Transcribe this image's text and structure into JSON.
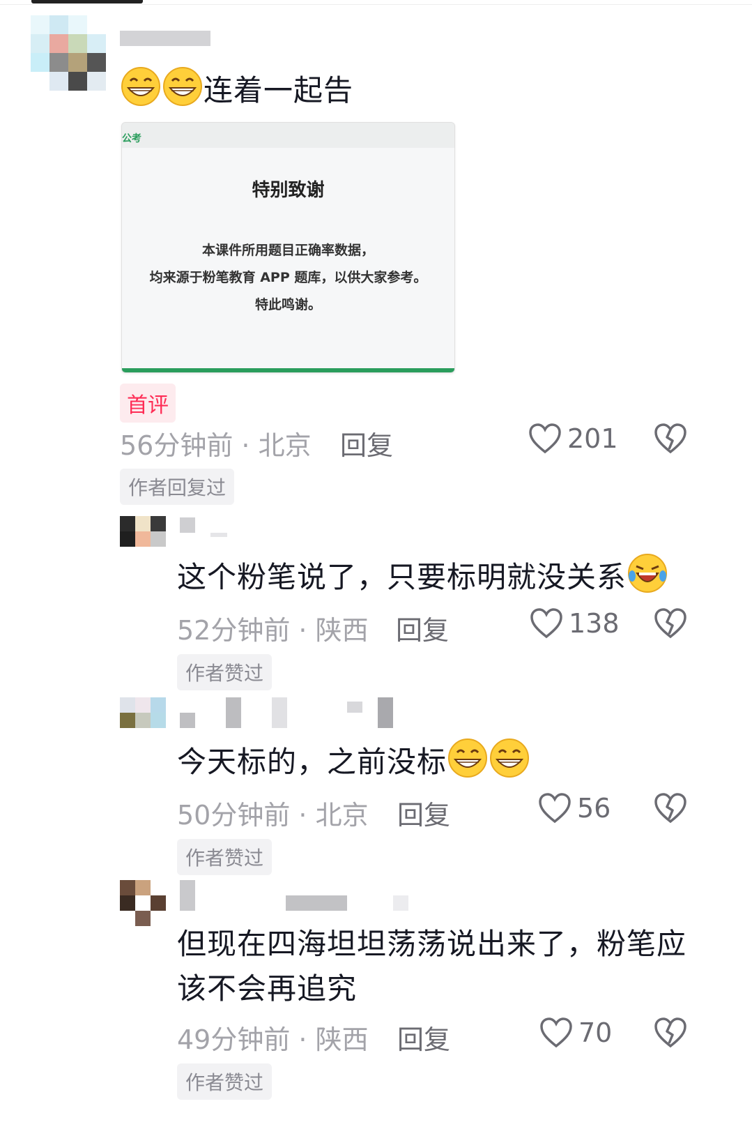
{
  "comments": [
    {
      "text_main": "连着一起告",
      "emojis": [
        "grin-emoji",
        "grin-emoji"
      ],
      "attachment": {
        "logo_text": "公考",
        "title": "特别致谢",
        "lines": [
          "本课件所用题目正确率数据，",
          "均来源于粉笔教育 APP 题库，以供大家参考。",
          "特此鸣谢。"
        ]
      },
      "first_badge": "首评",
      "time": "56分钟前 · 北京",
      "reply": "回复",
      "likes": "201",
      "badge": "作者回复过"
    },
    {
      "text_main": "这个粉笔说了，只要标明就没关系",
      "emojis": [
        "laugh-cry-emoji"
      ],
      "time": "52分钟前 · 陕西",
      "reply": "回复",
      "likes": "138",
      "badge": "作者赞过"
    },
    {
      "text_main": "今天标的，之前没标",
      "emojis": [
        "grin-emoji",
        "grin-emoji"
      ],
      "time": "50分钟前 · 北京",
      "reply": "回复",
      "likes": "56",
      "badge": "作者赞过"
    },
    {
      "text_line1": "但现在四海坦坦荡荡说出来了，粉笔应",
      "text_line2": "该不会再追究",
      "time": "49分钟前 · 陕西",
      "reply": "回复",
      "likes": "70",
      "badge": "作者赞过"
    }
  ],
  "colors": {
    "accent_red": "#fe2c55",
    "meta_gray": "#a3a3a9",
    "brand_green": "#2a9d5c"
  }
}
